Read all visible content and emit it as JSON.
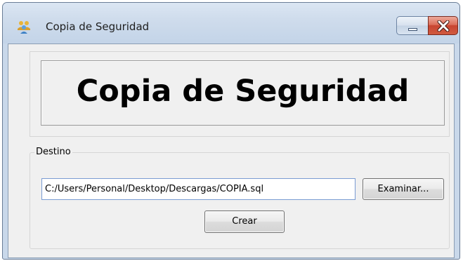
{
  "window": {
    "title": "Copia de Seguridad",
    "app_icon": "users-icon",
    "controls": {
      "minimize_icon": "minimize-icon",
      "close_icon": "close-icon"
    }
  },
  "header": {
    "title": "Copia de Seguridad"
  },
  "destino": {
    "group_label": "Destino",
    "path_value": "C:/Users/Personal/Desktop/Descargas/COPIA.sql",
    "browse_label": "Examinar...",
    "create_label": "Crear"
  },
  "colors": {
    "titlebar": "#cfdcec",
    "client_background": "#f0f0f0",
    "close_button": "#c84431",
    "input_border": "#7a9cd3"
  }
}
